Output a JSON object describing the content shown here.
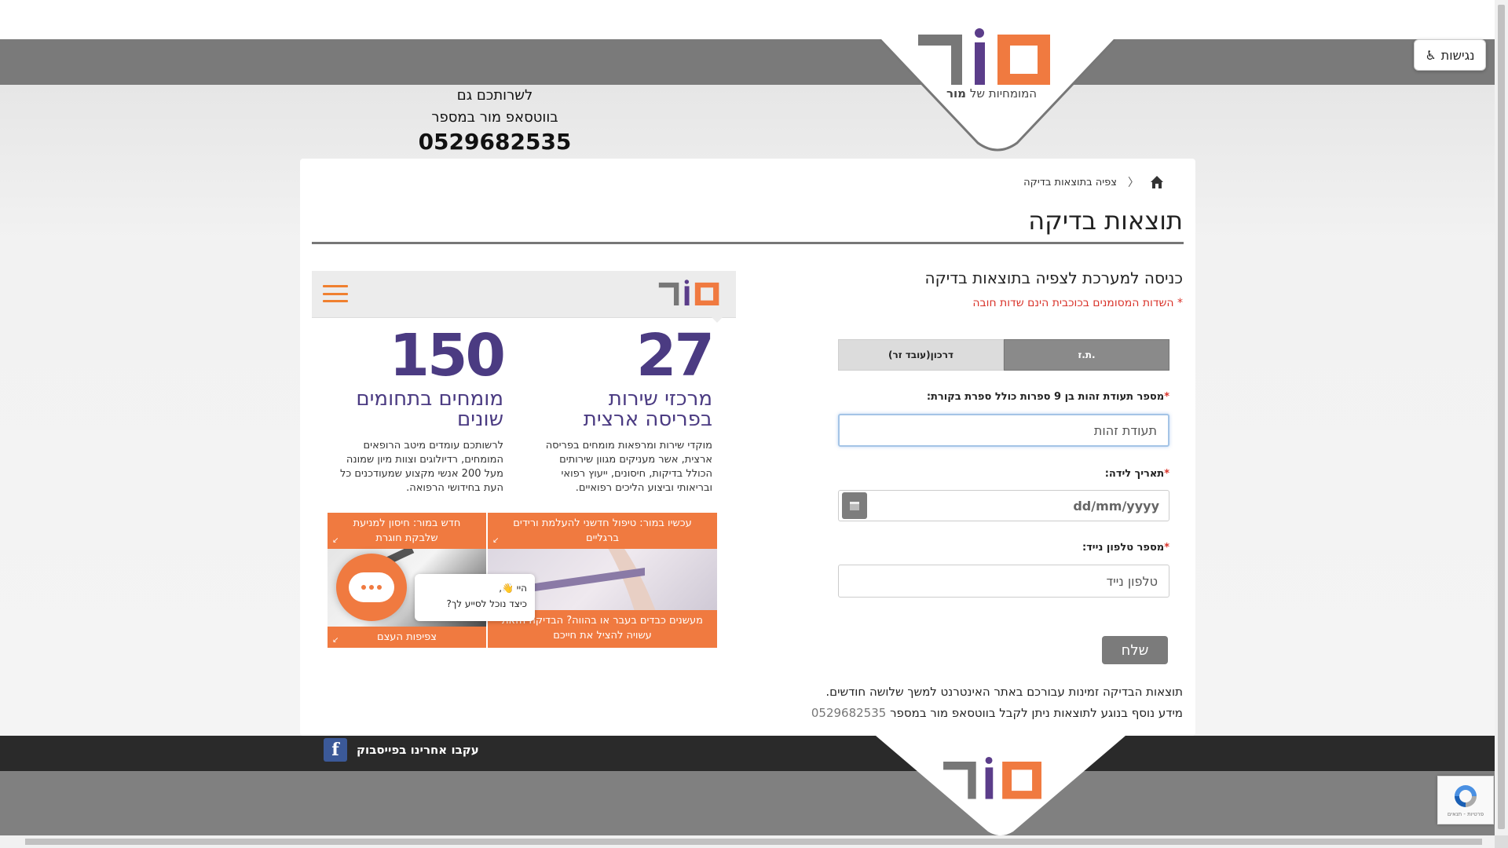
{
  "header": {
    "accessibility_label": "נגישות",
    "logo_tagline": "המומחיות של",
    "logo_tagline_brand": "מור",
    "whatsapp": {
      "line1": "לשרותכם גם",
      "line2": "בווטסאפ מור במספר",
      "number": "0529682535"
    }
  },
  "breadcrumb": {
    "current": "צפיה בתוצאות בדיקה"
  },
  "page": {
    "title": "תוצאות בדיקה"
  },
  "form": {
    "heading": "כניסה למערכת לצפיה בתוצאות בדיקה",
    "required_note": "* השדות המסומנים בכוכבית הינם שדות חובה",
    "tabs": {
      "id": "ת.ז.",
      "passport": "דרכון(עובד זר)"
    },
    "id_field": {
      "label": "מספר תעודת זהות בן 9 ספרות כולל ספרת בקורת:",
      "placeholder": "תעודת זהות"
    },
    "birth_field": {
      "label": "תאריך לידה:",
      "placeholder": "dd/mm/yyyy"
    },
    "phone_field": {
      "label": "מספר טלפון נייד:",
      "placeholder": "טלפון נייד"
    },
    "submit": "שלח"
  },
  "info": {
    "line1": "תוצאות הבדיקה זמינות עבורכם באתר האינטרנט למשך שלושה חודשים.",
    "line2": "מידע נוסף בנוגע לתוצאות ניתן לקבל בווטסאפ מור במספר",
    "phone": "0529682535"
  },
  "promo": {
    "stat1": {
      "value": "27",
      "title": "מרכזי שירות בפריסה ארצית",
      "desc": "מוקדי שירות ומרפאות מומחים בפריסה ארצית, אשר מעניקים מגוון שירותים הכולל בדיקות, חיסונים, ייעוץ רפואי ובריאותי וביצוע הליכים רפואיים."
    },
    "stat2": {
      "value": "150",
      "title": "מומחים בתחומים שונים",
      "desc": "לרשותכם עומדים מיטב הרופאים המומחים, רדיולוגים וצוות מיון שמונה מעל 200 אנשי מקצוע שמעודכנים כל העת בחידושי הרפואה."
    },
    "tiles": [
      {
        "caption": "עכשיו במור: טיפול חדשני להעלמת ורידים ברגליים"
      },
      {
        "caption": "חדש במור: חיסון למניעת שלבקת חוגרת"
      },
      {
        "caption": "מעשנים כבדים בעבר או בהווה? הבדיקה הזאת עשויה להציל את חייכם"
      },
      {
        "caption": "צפיפות העצם"
      }
    ]
  },
  "chat": {
    "greeting": "היי 👋,",
    "question": "כיצד נוכל לסייע לך?"
  },
  "footer": {
    "facebook": "עקבו אחרינו בפייסבוק"
  },
  "recaptcha": {
    "label": "פרטיות - תנאים"
  },
  "colors": {
    "brand_orange": "#f07a40",
    "brand_purple": "#4b3b82",
    "logo_gray": "#777777",
    "required_red": "#d9332a"
  }
}
